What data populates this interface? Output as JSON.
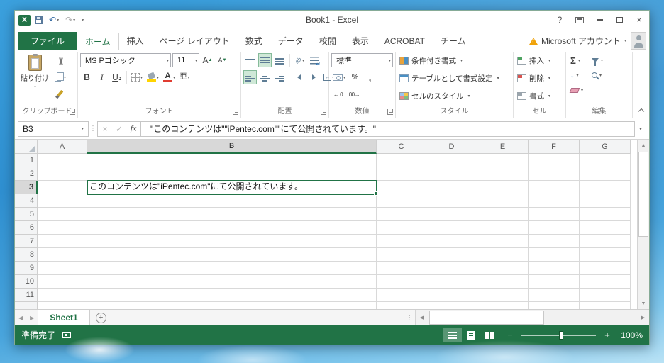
{
  "colors": {
    "accent_green": "#217346",
    "desktop_blue": "#3399db",
    "selection_green": "#217346"
  },
  "titlebar": {
    "title": "Book1 - Excel"
  },
  "ribbon_tabs": {
    "file": "ファイル",
    "active": "ホーム",
    "tabs": [
      "ホーム",
      "挿入",
      "ページ レイアウト",
      "数式",
      "データ",
      "校閲",
      "表示",
      "ACROBAT",
      "チーム"
    ],
    "account": "Microsoft アカウント"
  },
  "ribbon": {
    "clipboard": {
      "label": "クリップボード",
      "paste": "貼り付け"
    },
    "font": {
      "label": "フォント",
      "name": "MS Pゴシック",
      "size": "11"
    },
    "alignment": {
      "label": "配置"
    },
    "number": {
      "label": "数値",
      "format": "標準"
    },
    "styles": {
      "label": "スタイル",
      "conditional": "条件付き書式",
      "format_table": "テーブルとして書式設定",
      "cell_styles": "セルのスタイル"
    },
    "cells": {
      "label": "セル",
      "insert": "挿入",
      "delete": "削除",
      "format": "書式"
    },
    "editing": {
      "label": "編集"
    }
  },
  "formula_bar": {
    "name_box": "B3",
    "fx": "fx",
    "formula": "=\"このコンテンツは\"\"iPentec.com\"\"にて公開されています。\""
  },
  "grid": {
    "columns": [
      "A",
      "B",
      "C",
      "D",
      "E",
      "F",
      "G"
    ],
    "rows": [
      "1",
      "2",
      "3",
      "4",
      "5",
      "6",
      "7",
      "8",
      "9",
      "10",
      "11"
    ],
    "selected_cell": "B3",
    "selected_column": "B",
    "selected_row": "3",
    "cell_value": "このコンテンツは\"iPentec.com\"にて公開されています。"
  },
  "sheet_tabs": {
    "sheets": [
      "Sheet1"
    ],
    "active": "Sheet1"
  },
  "status_bar": {
    "mode": "準備完了",
    "zoom": "100%"
  }
}
